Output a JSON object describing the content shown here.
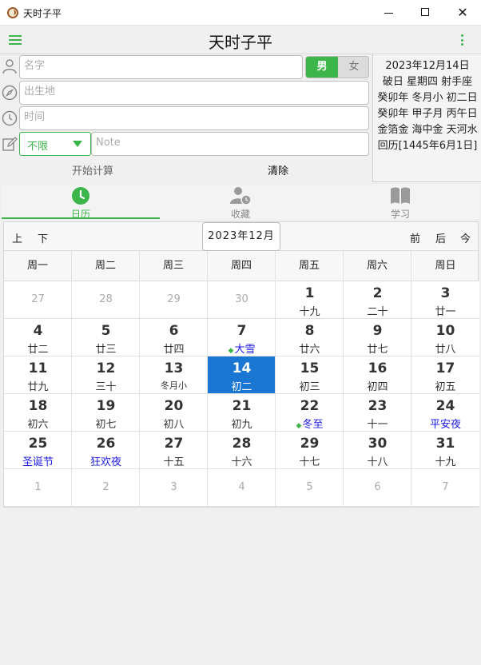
{
  "window": {
    "title": "天时子平"
  },
  "header": {
    "title": "天时子平"
  },
  "form": {
    "name_placeholder": "名字",
    "gender_male": "男",
    "gender_female": "女",
    "birthplace_placeholder": "出生地",
    "time_placeholder": "时间",
    "type_select": "不限",
    "note_placeholder": "Note",
    "start_label": "开始计算",
    "clear_label": "清除"
  },
  "info": {
    "lines": [
      "2023年12月14日",
      "破日 星期四 射手座",
      "癸卯年 冬月小 初二日",
      "癸卯年 甲子月 丙午日",
      "金箔金 海中金 天河水",
      "回历[1445年6月1日]"
    ]
  },
  "tabs": [
    {
      "label": "日历",
      "icon": "clock-icon",
      "active": true
    },
    {
      "label": "收藏",
      "icon": "user-clock-icon",
      "active": false
    },
    {
      "label": "学习",
      "icon": "book-icon",
      "active": false
    }
  ],
  "calendar": {
    "nav": {
      "prev_year": "上",
      "prev_month": "下",
      "month_label": "2023年12月",
      "next_month": "前",
      "next_year": "后",
      "today": "今"
    },
    "weekdays": [
      "周一",
      "周二",
      "周三",
      "周四",
      "周五",
      "周六",
      "周日"
    ],
    "weeks": [
      [
        {
          "d": "27",
          "l": "",
          "o": true
        },
        {
          "d": "28",
          "l": "",
          "o": true
        },
        {
          "d": "29",
          "l": "",
          "o": true
        },
        {
          "d": "30",
          "l": "",
          "o": true
        },
        {
          "d": "1",
          "l": "十九"
        },
        {
          "d": "2",
          "l": "二十"
        },
        {
          "d": "3",
          "l": "廿一"
        }
      ],
      [
        {
          "d": "4",
          "l": "廿二"
        },
        {
          "d": "5",
          "l": "廿三"
        },
        {
          "d": "6",
          "l": "廿四"
        },
        {
          "d": "7",
          "l": "大雪",
          "blue": true,
          "term": true
        },
        {
          "d": "8",
          "l": "廿六"
        },
        {
          "d": "9",
          "l": "廿七"
        },
        {
          "d": "10",
          "l": "廿八"
        }
      ],
      [
        {
          "d": "11",
          "l": "廿九"
        },
        {
          "d": "12",
          "l": "三十"
        },
        {
          "d": "13",
          "l": "冬月小",
          "small": true
        },
        {
          "d": "14",
          "l": "初二",
          "sel": true
        },
        {
          "d": "15",
          "l": "初三"
        },
        {
          "d": "16",
          "l": "初四"
        },
        {
          "d": "17",
          "l": "初五"
        }
      ],
      [
        {
          "d": "18",
          "l": "初六"
        },
        {
          "d": "19",
          "l": "初七"
        },
        {
          "d": "20",
          "l": "初八"
        },
        {
          "d": "21",
          "l": "初九"
        },
        {
          "d": "22",
          "l": "冬至",
          "blue": true,
          "term": true
        },
        {
          "d": "23",
          "l": "十一"
        },
        {
          "d": "24",
          "l": "平安夜",
          "blue": true
        }
      ],
      [
        {
          "d": "25",
          "l": "圣诞节",
          "blue": true
        },
        {
          "d": "26",
          "l": "狂欢夜",
          "blue": true
        },
        {
          "d": "27",
          "l": "十五"
        },
        {
          "d": "28",
          "l": "十六"
        },
        {
          "d": "29",
          "l": "十七"
        },
        {
          "d": "30",
          "l": "十八"
        },
        {
          "d": "31",
          "l": "十九"
        }
      ],
      [
        {
          "d": "1",
          "l": "",
          "o": true
        },
        {
          "d": "2",
          "l": "",
          "o": true
        },
        {
          "d": "3",
          "l": "",
          "o": true
        },
        {
          "d": "4",
          "l": "",
          "o": true
        },
        {
          "d": "5",
          "l": "",
          "o": true
        },
        {
          "d": "6",
          "l": "",
          "o": true
        },
        {
          "d": "7",
          "l": "",
          "o": true
        }
      ]
    ]
  },
  "colors": {
    "accent": "#3cb54a",
    "selected": "#1976d2",
    "festival": "#1a1ae6"
  }
}
